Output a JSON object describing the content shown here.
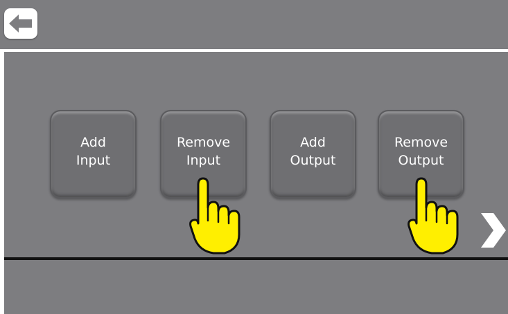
{
  "header": {
    "back_icon": "arrow-left-icon"
  },
  "menu": {
    "tiles": [
      {
        "label": "Add\nInput"
      },
      {
        "label": "Remove\nInput"
      },
      {
        "label": "Add\nOutput"
      },
      {
        "label": "Remove\nOutput"
      }
    ]
  },
  "navigation": {
    "next_icon": "chevron-right-icon"
  },
  "annotations": {
    "pointer_icon": "pointing-hand-icon",
    "pointer_color": "#ffef00"
  },
  "colors": {
    "panel": "#7d7d80",
    "tile": "#6f6f72",
    "divider": "#111111"
  }
}
